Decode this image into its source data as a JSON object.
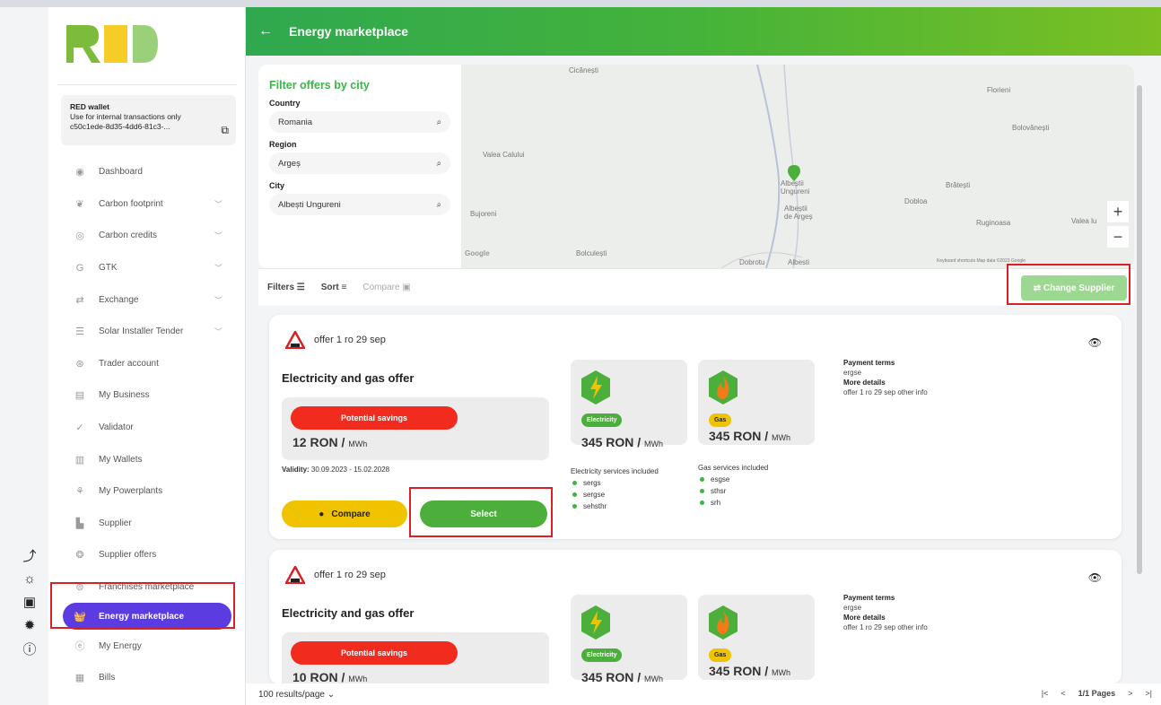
{
  "app": {
    "brand": "RED"
  },
  "wallet": {
    "title": "RED wallet",
    "subtitle": "Use for internal transactions only",
    "id": "c50c1ede-8d35-4dd6-81c3-..."
  },
  "sidebar": {
    "items": [
      {
        "label": "Dashboard",
        "icon": "dashboard-icon",
        "chevron": false
      },
      {
        "label": "Carbon footprint",
        "icon": "footprint-icon",
        "chevron": true
      },
      {
        "label": "Carbon credits",
        "icon": "credits-icon",
        "chevron": true
      },
      {
        "label": "GTK",
        "icon": "gtk-icon",
        "chevron": true
      },
      {
        "label": "Exchange",
        "icon": "exchange-icon",
        "chevron": true
      },
      {
        "label": "Solar Installer Tender",
        "icon": "solar-icon",
        "chevron": true
      },
      {
        "label": "Trader account",
        "icon": "trader-icon",
        "chevron": false
      },
      {
        "label": "My Business",
        "icon": "business-icon",
        "chevron": false
      },
      {
        "label": "Validator",
        "icon": "validator-icon",
        "chevron": false
      },
      {
        "label": "My Wallets",
        "icon": "wallets-icon",
        "chevron": false
      },
      {
        "label": "My Powerplants",
        "icon": "powerplants-icon",
        "chevron": false
      },
      {
        "label": "Supplier",
        "icon": "supplier-icon",
        "chevron": false
      },
      {
        "label": "Supplier offers",
        "icon": "supplier-offers-icon",
        "chevron": false
      },
      {
        "label": "Franchises marketplace",
        "icon": "franchise-icon",
        "chevron": false
      },
      {
        "label": "Energy marketplace",
        "icon": "basket-icon",
        "chevron": false,
        "active": true
      },
      {
        "label": "My Energy",
        "icon": "energy-icon",
        "chevron": false
      },
      {
        "label": "Bills",
        "icon": "bills-icon",
        "chevron": false
      }
    ]
  },
  "header": {
    "title": "Energy marketplace"
  },
  "filter": {
    "title": "Filter offers by city",
    "country_label": "Country",
    "country_value": "Romania",
    "region_label": "Region",
    "region_value": "Argeș",
    "city_label": "City",
    "city_value": "Albești Ungureni"
  },
  "map": {
    "places": [
      "Cicănești",
      "Florieni",
      "Valea Calului",
      "Bolovănești",
      "Albeștii Ungureni",
      "Albeștii de Argeș",
      "Brătești",
      "Dobloa",
      "Bujoreni",
      "Ruginoasa",
      "Valea lu",
      "Bolculești",
      "Dobrotu",
      "Albesti"
    ],
    "attribution": "Keyboard shortcuts   Map data ©2023 Google",
    "google": "Google"
  },
  "toolbar": {
    "filters": "Filters",
    "sort": "Sort",
    "compare": "Compare",
    "change_supplier": "Change Supplier"
  },
  "offers": [
    {
      "name": "offer 1 ro 29 sep",
      "title": "Electricity and gas offer",
      "savings_label": "Potential savings",
      "savings_value": "12 RON / ",
      "savings_unit": "MWh",
      "validity_label": "Validity:",
      "validity": "30.09.2023 - 15.02.2028",
      "compare": "Compare",
      "select": "Select",
      "electricity_badge": "Electricity",
      "electricity_price": "345 RON / ",
      "gas_badge": "Gas",
      "gas_price": "345 RON / ",
      "unit": "MWh",
      "elec_services_title": "Electricity services included",
      "elec_services": [
        "sergs",
        "sergse",
        "sehsthr"
      ],
      "gas_services_title": "Gas services included",
      "gas_services": [
        "esgse",
        "sthsr",
        "srh"
      ],
      "payment_terms_label": "Payment terms",
      "payment_terms": "ergse",
      "more_details_label": "More details",
      "more_details": "offer 1 ro 29 sep other info"
    },
    {
      "name": "offer 1 ro 29 sep",
      "title": "Electricity and gas offer",
      "savings_label": "Potential savings",
      "savings_value": "10 RON / ",
      "savings_unit": "MWh",
      "electricity_badge": "Electricity",
      "electricity_price": "345 RON / ",
      "gas_badge": "Gas",
      "gas_price": "345 RON / ",
      "unit": "MWh",
      "payment_terms_label": "Payment terms",
      "payment_terms": "ergse",
      "more_details_label": "More details",
      "more_details": "offer 1 ro 29 sep other info"
    }
  ],
  "footer": {
    "per_page": "100 results/page",
    "pages": "1/1 Pages"
  },
  "colors": {
    "accent": "#5b3ce0",
    "green": "#4caf3c",
    "red": "#f22b1f",
    "yellow": "#f0c300",
    "highlight": "#d92027"
  }
}
